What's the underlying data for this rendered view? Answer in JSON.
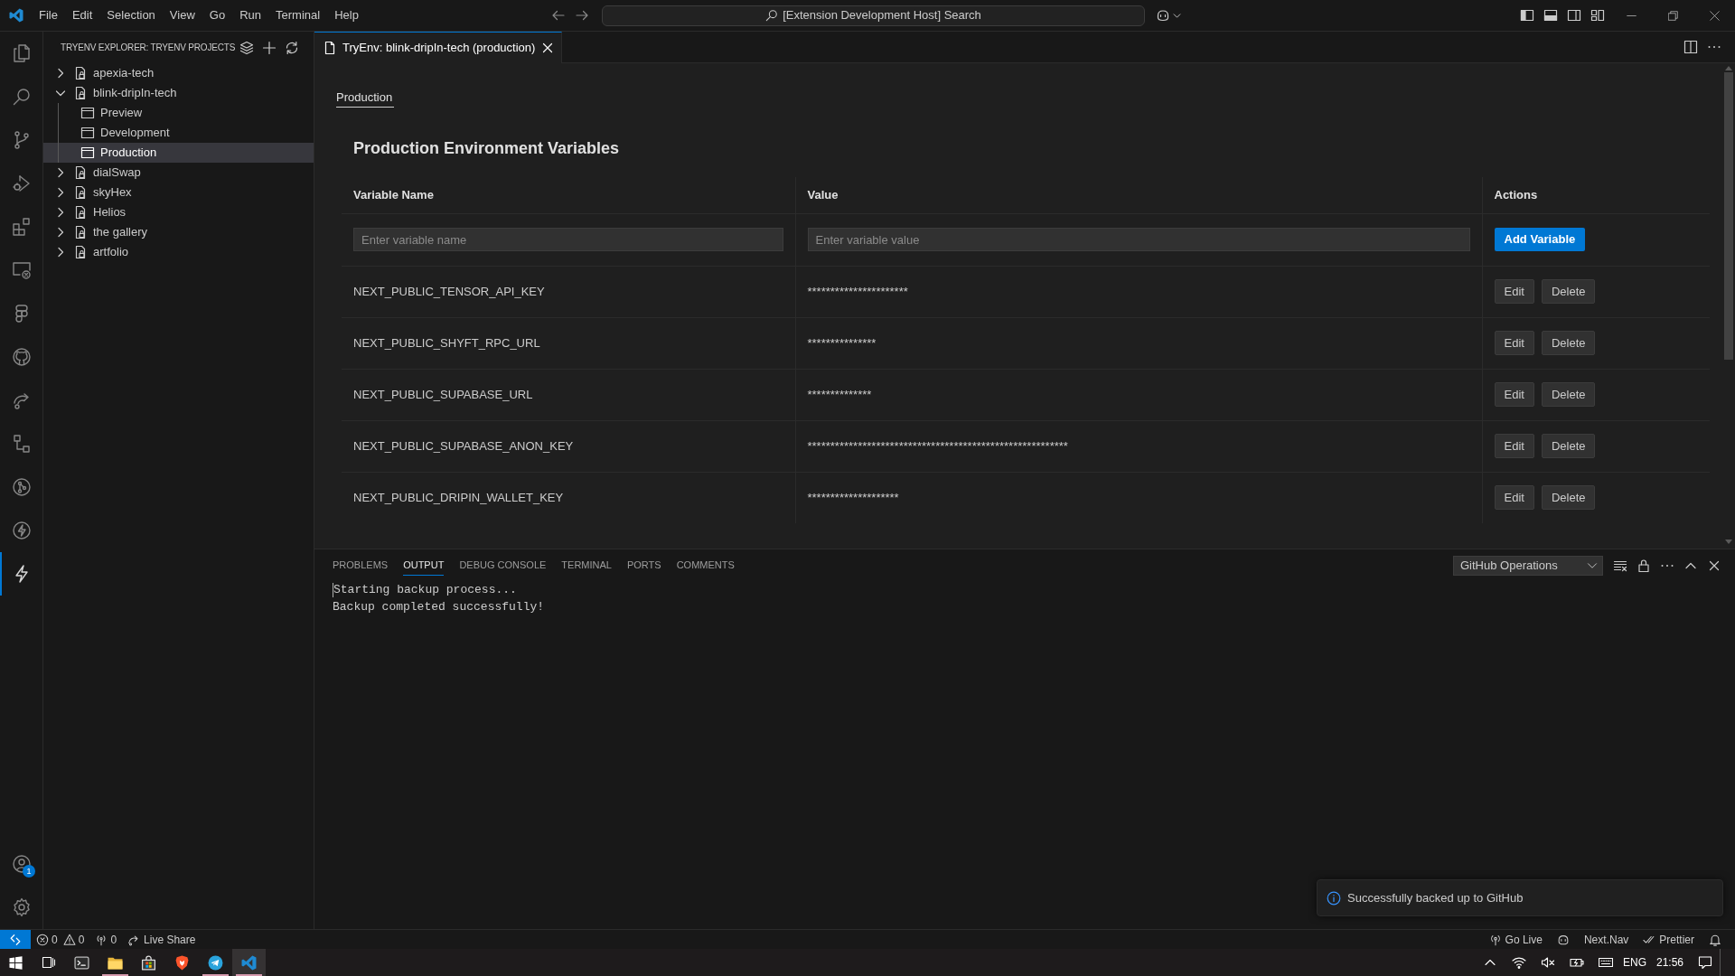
{
  "title_bar": {
    "menu": [
      "File",
      "Edit",
      "Selection",
      "View",
      "Go",
      "Run",
      "Terminal",
      "Help"
    ],
    "command_center": "[Extension Development Host] Search"
  },
  "activity_bar": {
    "items": [
      {
        "selected": false
      },
      {
        "selected": false
      },
      {
        "selected": false
      },
      {
        "selected": false
      },
      {
        "selected": false
      },
      {
        "selected": false
      },
      {
        "selected": false
      },
      {
        "selected": false
      },
      {
        "selected": false
      },
      {
        "selected": false
      },
      {
        "selected": false
      },
      {
        "selected": false
      },
      {
        "selected": true
      }
    ],
    "account_badge": "1"
  },
  "sidebar": {
    "title": "TRYENV EXPLORER: TRYENV PROJECTS",
    "tree": [
      {
        "label": "apexia-tech",
        "expanded": false,
        "selected": false
      },
      {
        "label": "blink-dripIn-tech",
        "expanded": true,
        "selected": false,
        "children": [
          {
            "label": "Preview",
            "selected": false
          },
          {
            "label": "Development",
            "selected": false
          },
          {
            "label": "Production",
            "selected": true
          }
        ]
      },
      {
        "label": "dialSwap",
        "expanded": false,
        "selected": false
      },
      {
        "label": "skyHex",
        "expanded": false,
        "selected": false
      },
      {
        "label": "Helios",
        "expanded": false,
        "selected": false
      },
      {
        "label": "the gallery",
        "expanded": false,
        "selected": false
      },
      {
        "label": "artfolio",
        "expanded": false,
        "selected": false
      }
    ]
  },
  "editor": {
    "tabs": [
      {
        "label": "TryEnv: blink-dripIn-tech (production)",
        "selected": true
      }
    ],
    "env_tabs": [
      {
        "label": "Production",
        "selected": true
      }
    ],
    "heading": "Production Environment Variables",
    "table": {
      "columns": [
        "Variable Name",
        "Value",
        "Actions"
      ],
      "new_row": {
        "name_field": {
          "placeholder": "Enter variable name"
        },
        "value_field": {
          "placeholder": "Enter variable value"
        },
        "button": "Add Variable"
      },
      "rows": [
        {
          "name": "NEXT_PUBLIC_TENSOR_API_KEY",
          "value": "**********************",
          "actions": [
            "Edit",
            "Delete"
          ]
        },
        {
          "name": "NEXT_PUBLIC_SHYFT_RPC_URL",
          "value": "***************",
          "actions": [
            "Edit",
            "Delete"
          ]
        },
        {
          "name": "NEXT_PUBLIC_SUPABASE_URL",
          "value": "**************",
          "actions": [
            "Edit",
            "Delete"
          ]
        },
        {
          "name": "NEXT_PUBLIC_SUPABASE_ANON_KEY",
          "value": "*********************************************************",
          "actions": [
            "Edit",
            "Delete"
          ]
        },
        {
          "name": "NEXT_PUBLIC_DRIPIN_WALLET_KEY",
          "value": "********************",
          "actions": [
            "Edit",
            "Delete"
          ]
        }
      ]
    }
  },
  "panel": {
    "tabs": [
      {
        "label": "PROBLEMS",
        "selected": false
      },
      {
        "label": "OUTPUT",
        "selected": true
      },
      {
        "label": "DEBUG CONSOLE",
        "selected": false
      },
      {
        "label": "TERMINAL",
        "selected": false
      },
      {
        "label": "PORTS",
        "selected": false
      },
      {
        "label": "COMMENTS",
        "selected": false
      }
    ],
    "channel": "GitHub Operations",
    "output": [
      "Starting backup process...",
      "Backup completed successfully!"
    ]
  },
  "notification": {
    "message": "Successfully backed up to GitHub"
  },
  "status_bar": {
    "errors": "0",
    "warnings": "0",
    "ports": "0",
    "live_share": "Live Share",
    "go_live": "Go Live",
    "next_nav": "Next.Nav",
    "prettier": "Prettier"
  },
  "taskbar": {
    "apps": [
      {
        "running": false,
        "selected": false
      },
      {
        "running": true,
        "selected": false
      },
      {
        "running": false,
        "selected": false
      },
      {
        "running": false,
        "selected": false
      },
      {
        "running": true,
        "selected": false
      },
      {
        "running": true,
        "selected": true
      }
    ],
    "language": "ENG",
    "time": "21:56"
  }
}
